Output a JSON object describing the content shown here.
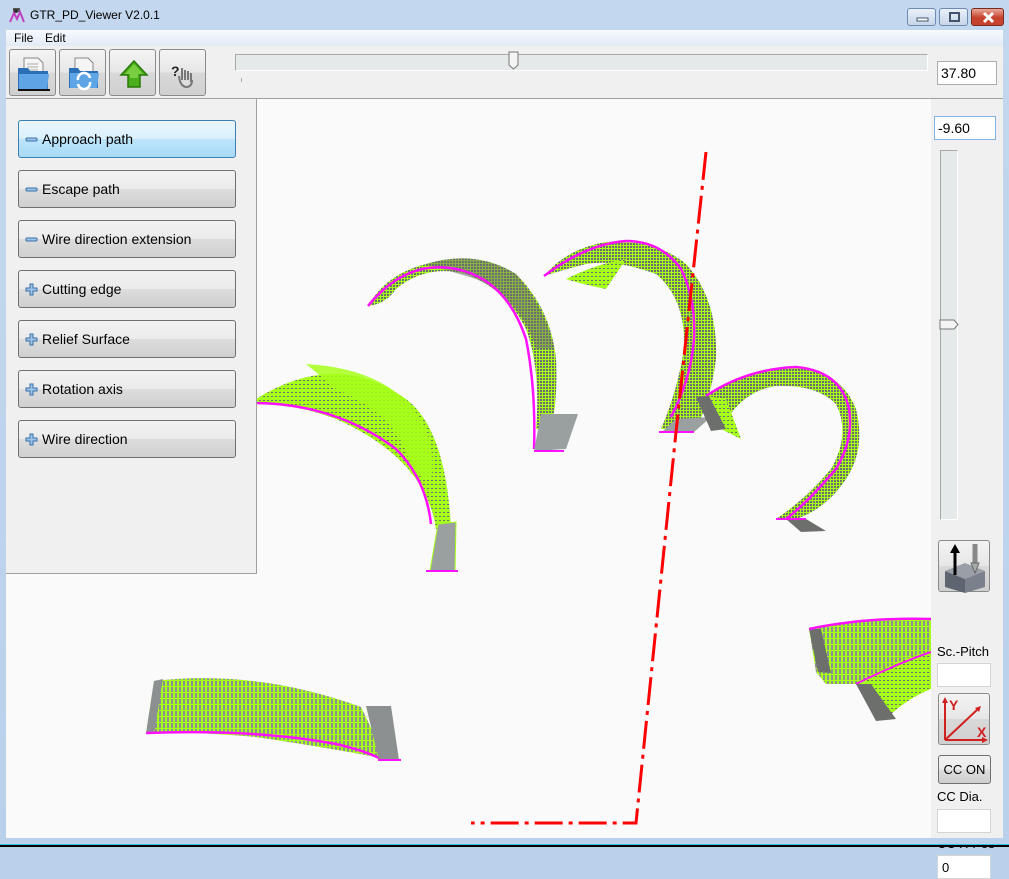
{
  "window": {
    "title": "GTR_PD_Viewer  V2.0.1",
    "controls": [
      "minimize",
      "maximize",
      "close"
    ]
  },
  "menu": {
    "items": [
      {
        "label": "File"
      },
      {
        "label": "Edit"
      }
    ]
  },
  "toolbar": {
    "buttons": [
      {
        "name": "open-file",
        "icon": "folder-document-icon"
      },
      {
        "name": "reload-file",
        "icon": "folder-refresh-icon"
      },
      {
        "name": "move-up",
        "icon": "green-up-arrow-icon"
      },
      {
        "name": "help-pointer",
        "icon": "hand-question-icon"
      }
    ],
    "horizontal_slider": {
      "value_fraction": 0.4
    },
    "horizontal_value": "37.80"
  },
  "side_panel": {
    "categories": [
      {
        "label": "Approach path",
        "state": "expanded",
        "active": true
      },
      {
        "label": "Escape path",
        "state": "expanded",
        "active": false
      },
      {
        "label": "Wire direction extension",
        "state": "expanded",
        "active": false
      },
      {
        "label": "Cutting edge",
        "state": "collapsed",
        "active": false
      },
      {
        "label": "Relief Surface",
        "state": "collapsed",
        "active": false
      },
      {
        "label": "Rotation axis",
        "state": "collapsed",
        "active": false
      },
      {
        "label": "Wire direction",
        "state": "collapsed",
        "active": false
      }
    ]
  },
  "right_panel": {
    "vertical_value": "-9.60",
    "vertical_slider": {
      "value_fraction": 0.47
    },
    "screw_pitch_button_icon": "tool-on-block-icon",
    "screw_pitch_label": "Sc.-Pitch",
    "screw_pitch_value": "",
    "axis_button_icon": "xy-axis-icon",
    "axis_labels": {
      "y": "Y",
      "x": "X"
    },
    "cc_button_label": "CC ON",
    "cc_dia_label": "CC Dia.",
    "cc_dia_value": "",
    "cc_xpos_label": "CC X-Pos",
    "cc_xpos_value": "0"
  },
  "viewport": {
    "description": "3D view of helical cutting-edge surfaces with approach paths",
    "colors": {
      "surface": "#a6ff1a",
      "surface_shade": "#6d6f6d",
      "edge": "#ff10ff",
      "end_face": "#9aa0a0",
      "axis_line": "#ff0000",
      "background": "#fafafa"
    }
  }
}
